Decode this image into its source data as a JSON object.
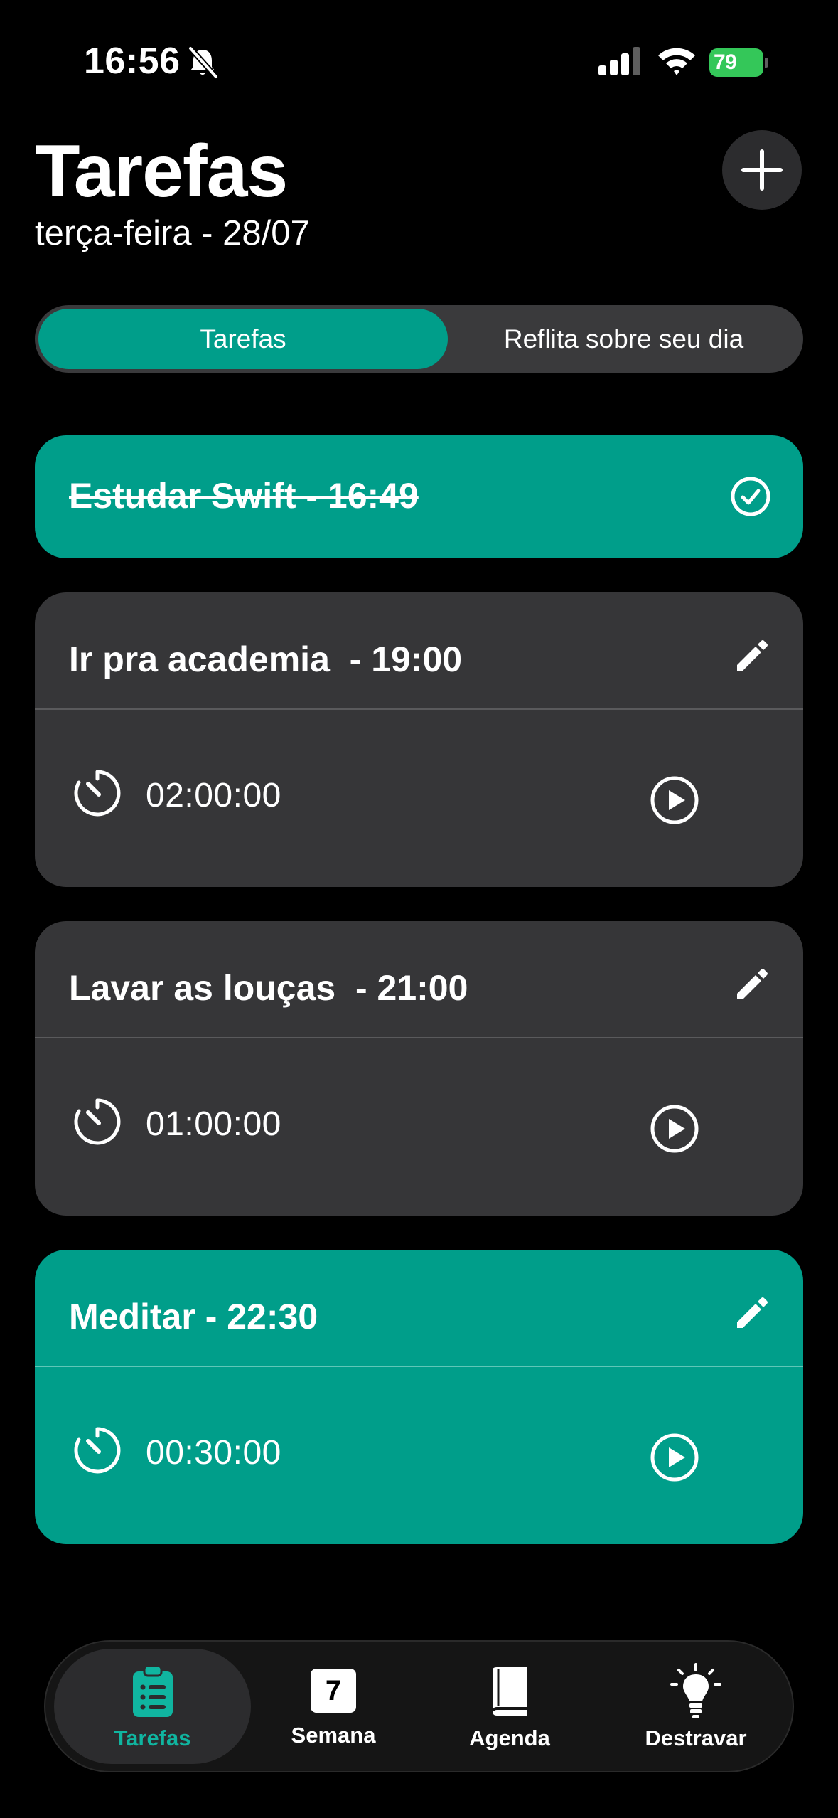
{
  "status_bar": {
    "time": "16:56",
    "battery_percent": "79",
    "icons": [
      "bell-slash-icon",
      "cellular-signal-icon",
      "wifi-icon",
      "battery-charging-icon"
    ]
  },
  "header": {
    "title": "Tarefas",
    "subtitle": "terça-feira - 28/07",
    "add_icon": "plus-icon"
  },
  "segmented_control": {
    "options": [
      "Tarefas",
      "Reflita sobre seu dia"
    ],
    "selected_index": 0
  },
  "tasks": [
    {
      "title": "Estudar Swift - 16:49",
      "completed": true,
      "icon": "checkmark-circle-icon"
    },
    {
      "title": "Ir pra academia  - 19:00",
      "timer": "02:00:00",
      "completed": false,
      "highlighted": false
    },
    {
      "title": "Lavar as louças  - 21:00",
      "timer": "01:00:00",
      "completed": false,
      "highlighted": false
    },
    {
      "title": "Meditar - 22:30",
      "timer": "00:30:00",
      "completed": false,
      "highlighted": true
    }
  ],
  "tab_bar": {
    "tabs": [
      {
        "label": "Tarefas",
        "icon": "clipboard-list-icon",
        "active": true
      },
      {
        "label": "Semana",
        "icon": "calendar-day-icon",
        "day_number": "7",
        "active": false
      },
      {
        "label": "Agenda",
        "icon": "book-icon",
        "active": false
      },
      {
        "label": "Destravar",
        "icon": "lightbulb-icon",
        "active": false
      }
    ]
  },
  "colors": {
    "background": "#000000",
    "accent_teal": "#009e8a",
    "card_dark": "#363638",
    "active_tab_label": "#10b5a0",
    "battery_green": "#34c759"
  }
}
